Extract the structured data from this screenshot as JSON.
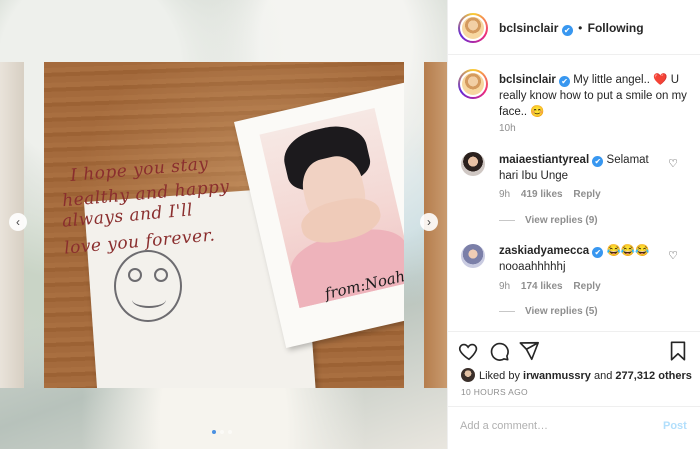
{
  "post": {
    "author": "bclsinclair",
    "follow_state": "Following",
    "separator": "•",
    "verified_glyph": "✔",
    "caption_text": "My little angel.. ❤️ U really know how to put a smile on my face.. 😊",
    "caption_age": "10h"
  },
  "image": {
    "handwriting_lines": [
      "I hope you stay",
      "healthy and happy",
      "always and I'll",
      "love you forever."
    ],
    "signature": "from:Noah",
    "carousel_dots": 3,
    "active_dot": 0
  },
  "comments": [
    {
      "username": "maiaestiantyreal",
      "text": "Selamat hari Ibu Unge",
      "age": "9h",
      "likes": "419 likes",
      "reply_label": "Reply",
      "view_replies": "View replies (9)"
    },
    {
      "username": "zaskiadyamecca",
      "text": "😂😂😂 nooaahhhhhj",
      "age": "9h",
      "likes": "174 likes",
      "reply_label": "Reply",
      "view_replies": "View replies (5)"
    }
  ],
  "actions": {
    "icons": [
      "heart-icon",
      "comment-icon",
      "share-icon",
      "bookmark-icon"
    ]
  },
  "likes": {
    "prefix": "Liked by",
    "first_user": "irwanmussry",
    "conjunction": "and",
    "others": "277,312 others"
  },
  "timestamp": "10 HOURS AGO",
  "comment_box": {
    "placeholder": "Add a comment…",
    "post_label": "Post"
  },
  "colors": {
    "verified": "#3897f0",
    "post_disabled": "#b2dffc",
    "heart_red": "#ed4956"
  }
}
